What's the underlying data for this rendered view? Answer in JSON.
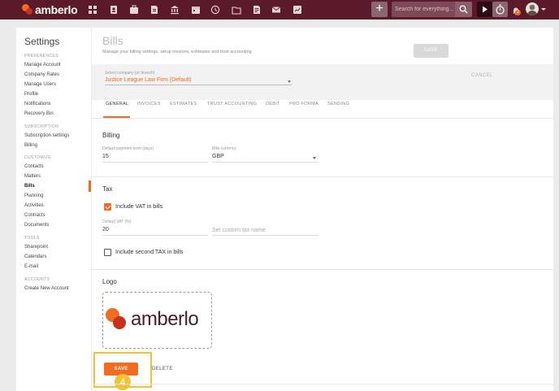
{
  "topbar": {
    "brand": "amberlo",
    "search_placeholder": "Search for everything...",
    "plus_label": "+",
    "notification_count": "2"
  },
  "sidebar": {
    "title": "Settings",
    "sections": [
      {
        "label": "PREFERENCES",
        "items": [
          "Manage Account",
          "Company Rates",
          "Manage Users",
          "Profile",
          "Notifications",
          "Recovery Bin"
        ]
      },
      {
        "label": "SUBSCRIPTION",
        "items": [
          "Subscription settings",
          "Billing"
        ]
      },
      {
        "label": "CUSTOMIZE",
        "items": [
          "Contacts",
          "Matters",
          "Bills",
          "Planning",
          "Activities",
          "Contracts",
          "Documents"
        ]
      },
      {
        "label": "TOOLS",
        "items": [
          "Sharepoint",
          "Calendars",
          "E-mail"
        ]
      },
      {
        "label": "ACCOUNTS",
        "items": [
          "Create New Account"
        ]
      }
    ],
    "active_item": "Bills"
  },
  "main": {
    "title": "Bills",
    "subtitle": "Manage your billing settings, setup invoices, estimates and trust accounting",
    "company": {
      "label": "Select company (or branch)",
      "value": "Justice League Law Firm (Default)"
    },
    "cancel_label": "CANCEL",
    "save_label": "SAVE",
    "tabs": [
      "GENERAL",
      "INVOICES",
      "ESTIMATES",
      "TRUST ACCOUNTING",
      "DEBIT",
      "PRO FORMA",
      "SENDING"
    ],
    "active_tab": "GENERAL",
    "billing": {
      "title": "Billing",
      "payment_term_label": "Default payment term (days)",
      "payment_term_value": "15",
      "currency_label": "Bills currency",
      "currency_value": "GBP"
    },
    "tax": {
      "title": "Tax",
      "include_vat_label": "Include VAT in bills",
      "include_vat_checked": true,
      "default_vat_label": "Default VAT (%)",
      "default_vat_value": "20",
      "custom_tax_placeholder": "Set custom tax name",
      "second_tax_label": "Include second TAX in bills",
      "second_tax_checked": false
    },
    "logo": {
      "title": "Logo",
      "brand_text": "amberlo",
      "save_label": "SAVE",
      "delete_label": "DELETE"
    },
    "step_number": "4"
  },
  "colors": {
    "topbar": "#5a1a2a",
    "accent": "#f26b1f",
    "highlight": "#f2c230"
  }
}
